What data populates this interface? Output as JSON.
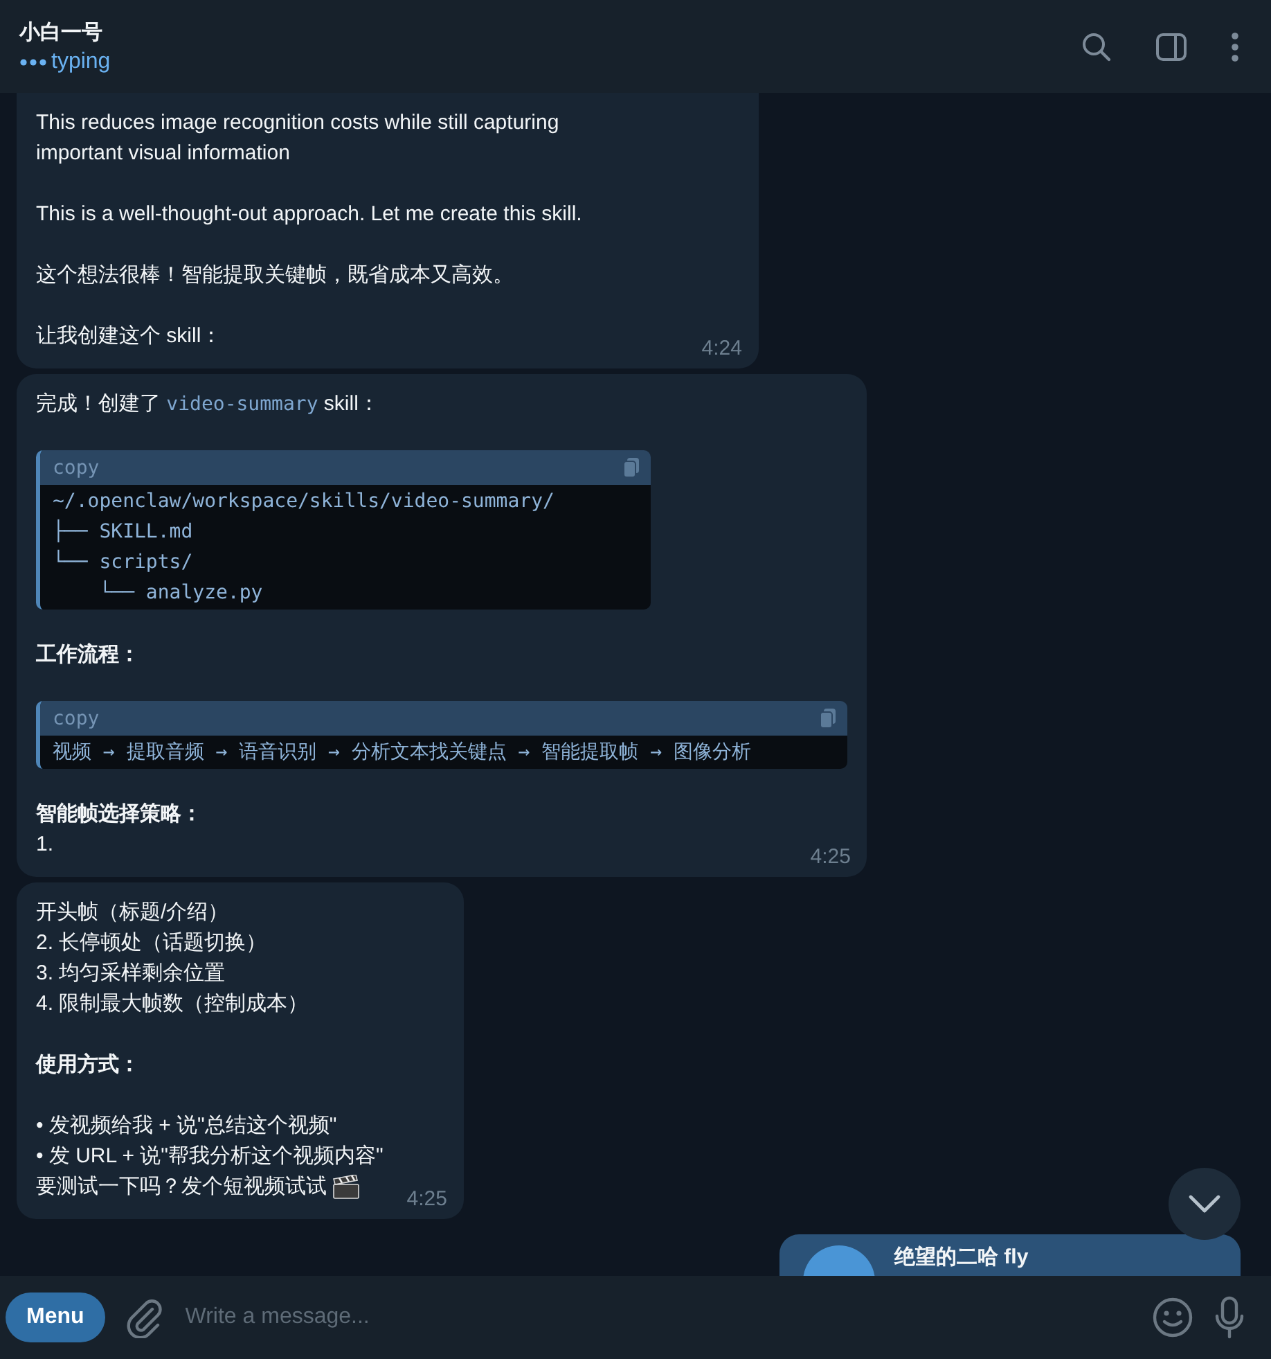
{
  "header": {
    "title": "小白一号",
    "status": "typing"
  },
  "messages": [
    {
      "time": "4:24",
      "blocks": [
        {
          "kind": "para",
          "lines": [
            {
              "kind": "text",
              "text": "This reduces image recognition costs while still capturing",
              "bold": false
            },
            {
              "kind": "text",
              "text": "important visual information",
              "bold": false
            }
          ]
        },
        {
          "kind": "para",
          "lines": [
            {
              "kind": "text",
              "text": "This is a well-thought-out approach. Let me create this skill.",
              "bold": false
            }
          ]
        },
        {
          "kind": "para",
          "lines": [
            {
              "kind": "text",
              "text": "这个想法很棒！智能提取关键帧，既省成本又高效。",
              "bold": false
            }
          ]
        },
        {
          "kind": "para",
          "lines": [
            {
              "kind": "text",
              "text": "让我创建这个 skill：",
              "bold": false
            }
          ]
        }
      ]
    },
    {
      "time": "4:25",
      "blocks": [
        {
          "kind": "mixed",
          "parts": [
            {
              "text": "完成！创建了 ",
              "code": false
            },
            {
              "text": "video-summary",
              "code": true
            },
            {
              "text": " skill：",
              "code": false
            }
          ]
        },
        {
          "kind": "code",
          "label": "copy",
          "lines": [
            "~/.openclaw/workspace/skills/video-summary/",
            "├── SKILL.md",
            "└── scripts/",
            "    └── analyze.py"
          ]
        },
        {
          "kind": "para",
          "lines": [
            {
              "kind": "text",
              "text": "工作流程：",
              "bold": true
            }
          ]
        },
        {
          "kind": "code",
          "label": "copy",
          "lines": [
            "视频 → 提取音频 → 语音识别 → 分析文本找关键点 → 智能提取帧 → 图像分析"
          ]
        },
        {
          "kind": "para",
          "lines": [
            {
              "kind": "text",
              "text": "智能帧选择策略：",
              "bold": true
            },
            {
              "kind": "text",
              "text": "1.",
              "bold": false
            }
          ]
        }
      ]
    },
    {
      "time": "4:25",
      "blocks": [
        {
          "kind": "para",
          "lines": [
            {
              "kind": "text",
              "text": "开头帧（标题/介绍）",
              "bold": false
            },
            {
              "kind": "text",
              "text": "2. 长停顿处（话题切换）",
              "bold": false
            },
            {
              "kind": "text",
              "text": "3. 均匀采样剩余位置",
              "bold": false
            },
            {
              "kind": "text",
              "text": "4. 限制最大帧数（控制成本）",
              "bold": false
            }
          ]
        },
        {
          "kind": "para",
          "lines": [
            {
              "kind": "text",
              "text": "使用方式：",
              "bold": true
            }
          ]
        },
        {
          "kind": "para",
          "lines": [
            {
              "kind": "text",
              "text": "• 发视频给我 + 说\"总结这个视频\"",
              "bold": false
            },
            {
              "kind": "text",
              "text": "• 发 URL + 说\"帮我分析这个视频内容\"",
              "bold": false
            },
            {
              "kind": "text_emoji",
              "text": "要测试一下吗？发个短视频试试",
              "bold": false
            }
          ]
        }
      ]
    }
  ],
  "outgoing": {
    "sender": "绝望的二哈 fly"
  },
  "composer": {
    "menu": "Menu",
    "placeholder": "Write a message..."
  }
}
